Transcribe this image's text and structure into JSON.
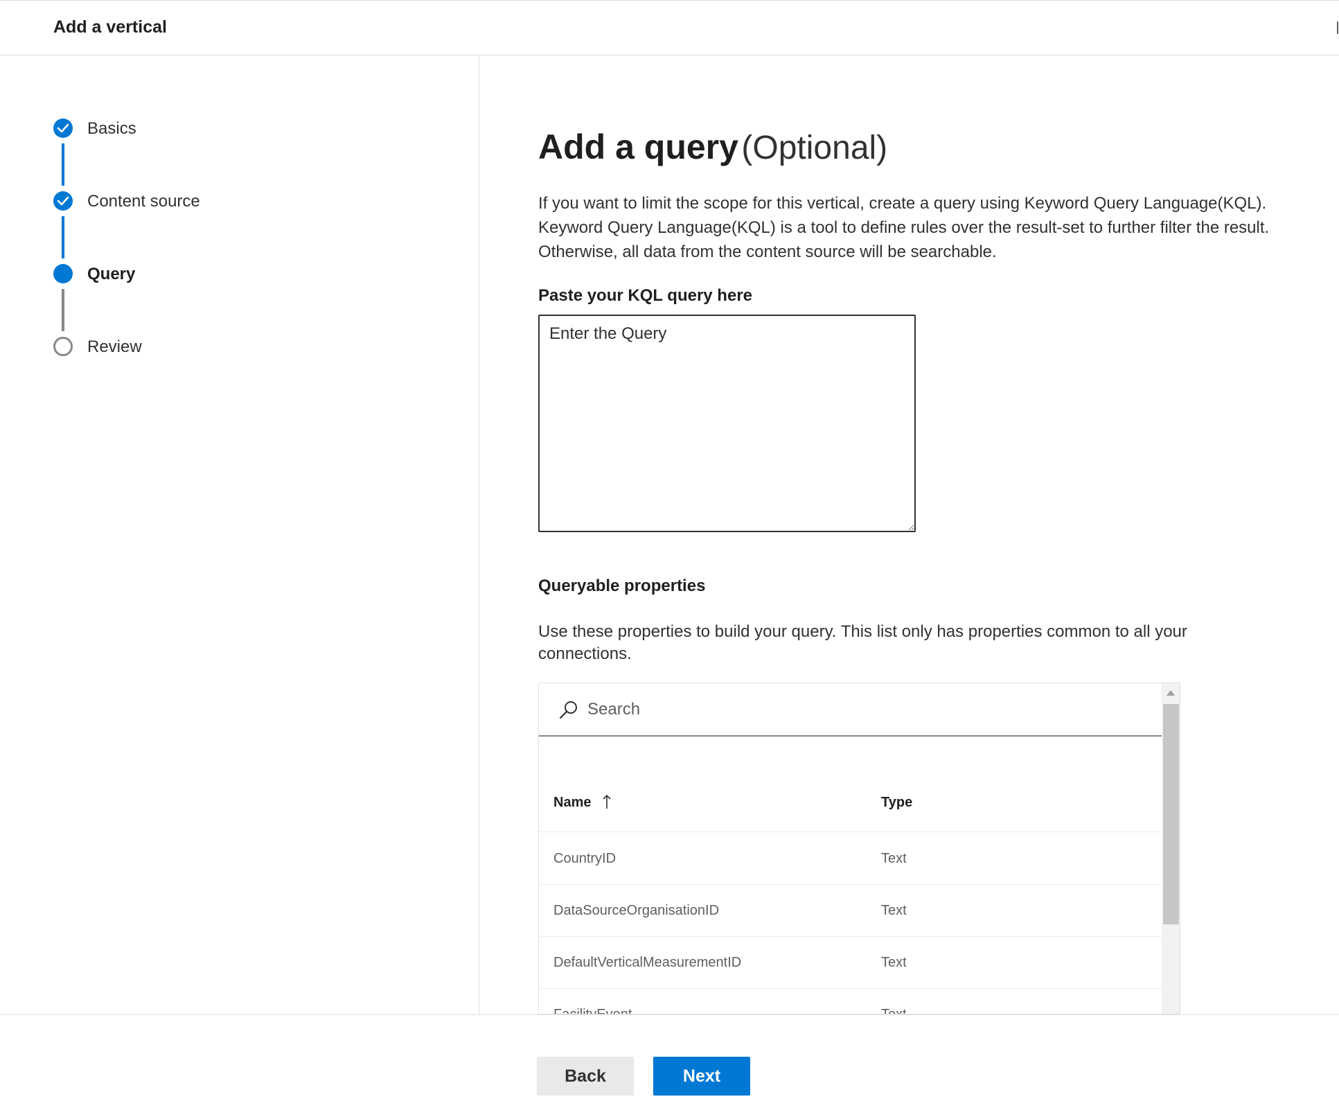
{
  "header": {
    "title": "Add a vertical"
  },
  "steps": [
    {
      "label": "Basics",
      "status": "completed",
      "icon": "checkmark-icon"
    },
    {
      "label": "Content source",
      "status": "completed",
      "icon": "checkmark-icon"
    },
    {
      "label": "Query",
      "status": "current",
      "icon": "filled-circle-icon"
    },
    {
      "label": "Review",
      "status": "pending",
      "icon": "empty-circle-icon"
    }
  ],
  "main": {
    "title": "Add a query",
    "title_suffix": "(Optional)",
    "description_lines": [
      "If you want to limit the scope for this vertical, create a query using Keyword Query Language(KQL).",
      "Keyword Query Language(KQL) is a tool to define rules over the result-set to further filter the result.",
      "Otherwise, all data from the content source will be searchable."
    ],
    "query_label": "Paste your KQL query here",
    "query_placeholder": "Enter the Query",
    "query_value": ""
  },
  "properties": {
    "title": "Queryable properties",
    "description": "Use these properties to build your query. This list only has properties common to all your connections.",
    "search_placeholder": "Search",
    "columns": {
      "name": "Name",
      "type": "Type",
      "sort": "ascending",
      "sort_icon": "arrow-up-icon"
    },
    "rows": [
      {
        "name": "CountryID",
        "type": "Text"
      },
      {
        "name": "DataSourceOrganisationID",
        "type": "Text"
      },
      {
        "name": "DefaultVerticalMeasurementID",
        "type": "Text"
      },
      {
        "name": "FacilityEvent",
        "type": "Text"
      }
    ]
  },
  "footer": {
    "back_label": "Back",
    "next_label": "Next"
  },
  "colors": {
    "accent": "#0078d4",
    "pending": "#8a8886",
    "text": "#323130",
    "border": "#e1dfdd"
  }
}
